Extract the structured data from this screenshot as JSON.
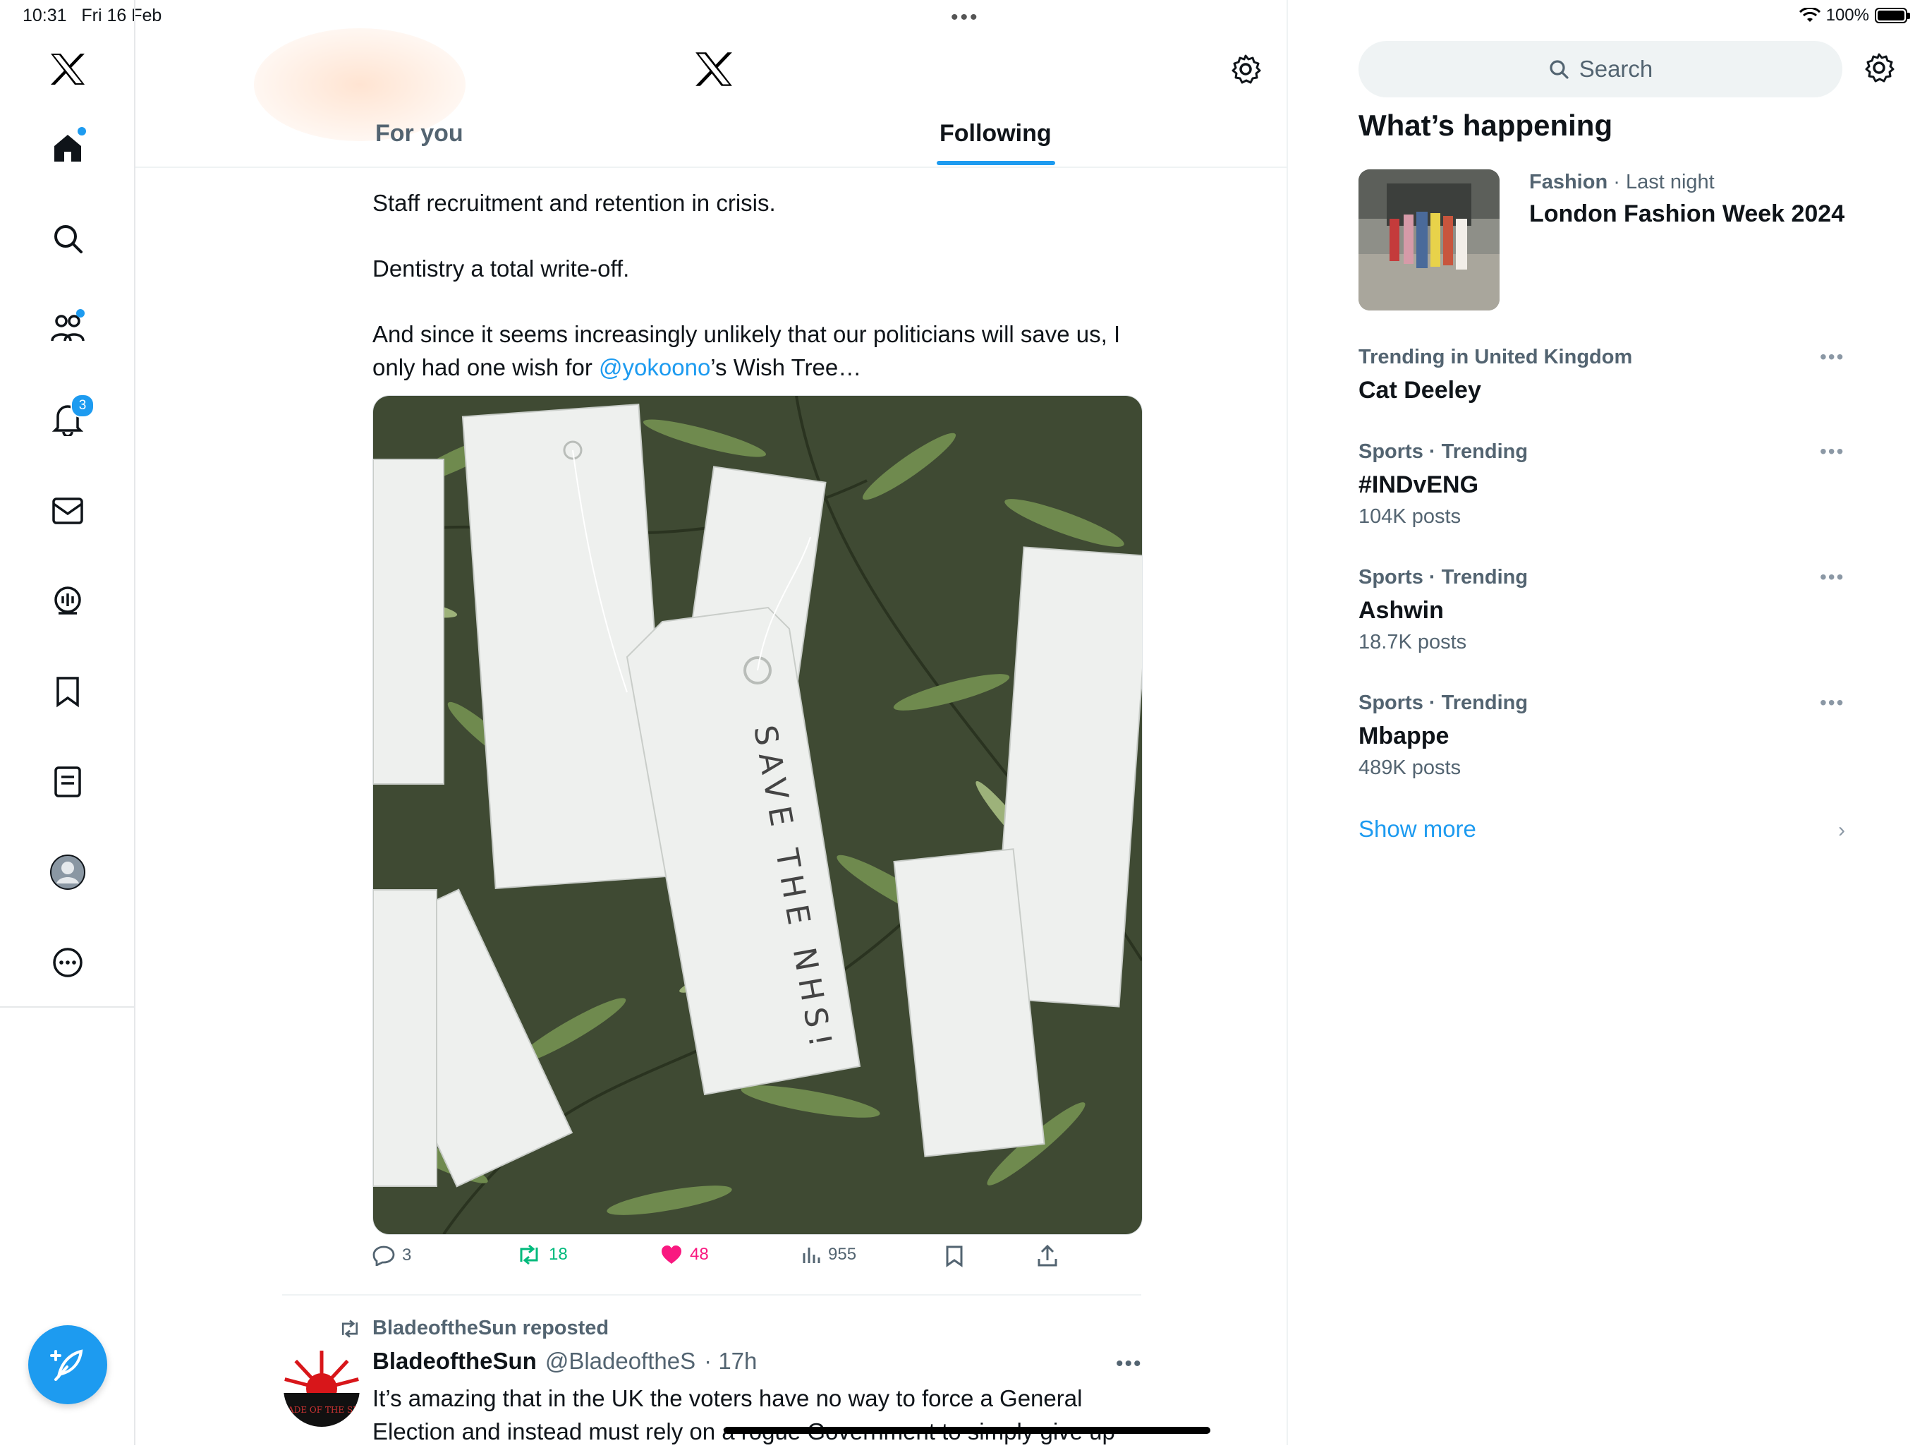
{
  "status_bar": {
    "time": "10:31",
    "date": "Fri 16 Feb",
    "battery": "100%"
  },
  "nav": {
    "items": [
      {
        "name": "x-logo-icon"
      },
      {
        "name": "home-icon"
      },
      {
        "name": "search-icon"
      },
      {
        "name": "communities-icon"
      },
      {
        "name": "notifications-icon",
        "badge": "3"
      },
      {
        "name": "messages-icon"
      },
      {
        "name": "spaces-icon"
      },
      {
        "name": "bookmarks-icon"
      },
      {
        "name": "lists-icon"
      },
      {
        "name": "profile-avatar"
      },
      {
        "name": "more-icon"
      }
    ],
    "notifications_badge": "3"
  },
  "header": {
    "tabs": [
      {
        "label": "For you",
        "active": false
      },
      {
        "label": "Following",
        "active": true
      }
    ]
  },
  "tweet": {
    "text_1": "Staff recruitment and retention in crisis.",
    "text_2": "Dentistry a total write-off.",
    "text_3a": "And since it seems increasingly unlikely that our politicians will save us, I only had one wish for ",
    "mention": "@yokoono",
    "text_3b": "’s Wish Tree…",
    "image_tag_text": "SAVE THE NHS!",
    "replies": "3",
    "reposts": "18",
    "likes": "48",
    "views": "955"
  },
  "tweet2": {
    "repost_label": "BladeoftheSun reposted",
    "name": "BladeoftheSun",
    "handle": "@BladeoftheS",
    "time": "· 17h",
    "text": "It’s amazing that in the UK the voters have no way to force a General Election and instead must rely on a rogue Government to simply give up"
  },
  "sidebar": {
    "search_placeholder": "Search",
    "heading": "What’s happening",
    "featured": {
      "category": "Fashion",
      "time": " · Last night",
      "title": "London Fashion Week 2024"
    },
    "trends": [
      {
        "meta": "Trending in United Kingdom",
        "title": "Cat Deeley",
        "count": ""
      },
      {
        "meta": "Sports · Trending",
        "title": "#INDvENG",
        "count": "104K posts"
      },
      {
        "meta": "Sports · Trending",
        "title": "Ashwin",
        "count": "18.7K posts"
      },
      {
        "meta": "Sports · Trending",
        "title": "Mbappe",
        "count": "489K posts"
      }
    ],
    "show_more": "Show more"
  },
  "colors": {
    "accent": "#1d9bf0",
    "like": "#f91880",
    "repost": "#00ba7c",
    "secondary_text": "#536471"
  }
}
